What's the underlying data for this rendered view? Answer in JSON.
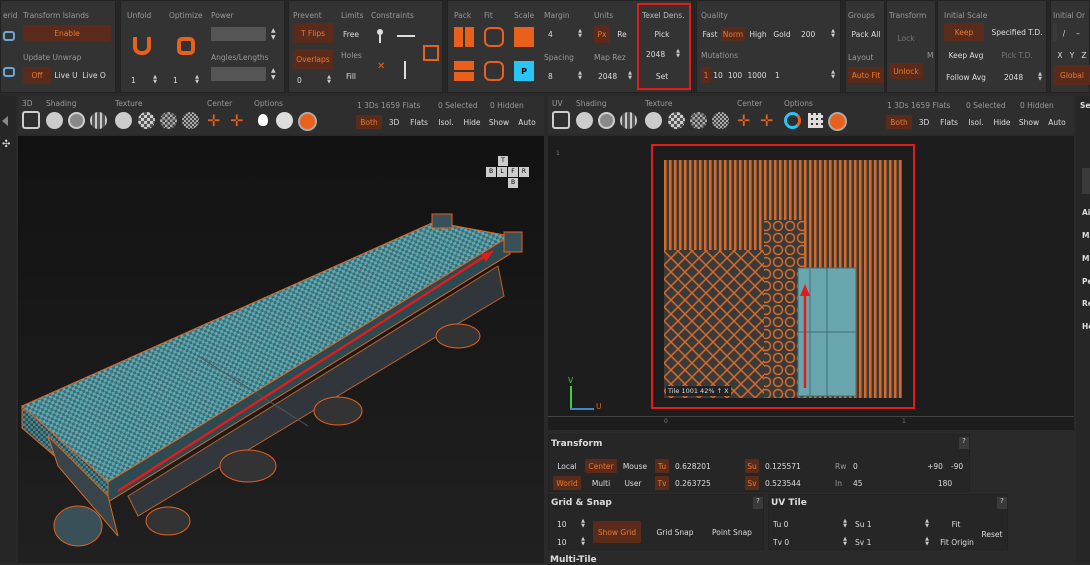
{
  "top": {
    "left_partial": {
      "erid": "erid",
      "transform_islands": "Transform Islands",
      "enable": "Enable",
      "update_unwrap": "Update Unwrap",
      "off": "Off",
      "live_u": "Live U",
      "live_o": "Live O"
    },
    "unfold": {
      "unfold": "Unfold",
      "optimize": "Optimize",
      "power": "Power",
      "angles": "Angles/Lengths",
      "v1": "1",
      "v2": "1"
    },
    "prevent": {
      "prevent": "Prevent",
      "tflips": "T Flips",
      "overlaps": "Overlaps",
      "limits": "Limits",
      "free": "Free",
      "holes": "Holes",
      "fill": "Fill",
      "constraints": "Constraints",
      "v0": "0"
    },
    "pack": {
      "pack": "Pack",
      "fit": "Fit",
      "scale": "Scale",
      "margin": "Margin",
      "margin_val": "4",
      "spacing": "Spacing",
      "spacing_val": "8",
      "units": "Units",
      "px": "Px",
      "re": "Re",
      "map_rez": "Map Rez",
      "map_rez_val": "2048"
    },
    "texel": {
      "title": "Texel Dens.",
      "pick": "Pick",
      "val": "2048",
      "set": "Set"
    },
    "quality": {
      "quality": "Quality",
      "fast": "Fast",
      "norm": "Norm",
      "high": "High",
      "gold": "Gold",
      "gold_val": "200",
      "mutations": "Mutations",
      "m1": "1",
      "m10": "10",
      "m100": "100",
      "m1000": "1000",
      "mval": "1"
    },
    "groups": {
      "groups": "Groups",
      "pack_all": "Pack All",
      "layout": "Layout",
      "auto_fit": "Auto Fit"
    },
    "transform": {
      "transform": "Transform",
      "lock": "Lock",
      "unlock": "Unlock",
      "m": "M"
    },
    "initial_scale": {
      "title": "Initial Scale",
      "keep": "Keep",
      "specified": "Specified T.D.",
      "keep_avg": "Keep Avg",
      "pick_td": "Pick T.D.",
      "follow_avg": "Follow Avg",
      "follow_val": "2048"
    },
    "initial_or": {
      "title": "Initial Or",
      "slash": "/",
      "dash": "–",
      "x": "X",
      "y": "Y",
      "z": "Z",
      "global": "Global"
    }
  },
  "view3d": {
    "tabs": [
      "3D",
      "Shading",
      "Texture",
      "Center",
      "Options"
    ],
    "info": "1 3Ds 1659 Flats",
    "selected": "0 Selected",
    "hidden": "0 Hidden",
    "filters": [
      "Both",
      "3D",
      "Flats",
      "Isol.",
      "Hide",
      "Show",
      "Auto"
    ],
    "cube": {
      "t": "T",
      "b": "B",
      "l": "L",
      "f": "F",
      "r": "R",
      "bk": "B"
    }
  },
  "viewuv": {
    "tabs": [
      "UV",
      "Shading",
      "Texture",
      "Center",
      "Options"
    ],
    "info": "1 3Ds 1659 Flats",
    "selected": "0 Selected",
    "hidden": "0 Hidden",
    "filters": [
      "Both",
      "3D",
      "Flats",
      "Isol.",
      "Hide",
      "Show",
      "Auto"
    ],
    "tile_label": "Tile 1001 42% ↑ X",
    "axis_v": "V",
    "axis_u": "U",
    "ruler_1": "1",
    "ruler_0": "0",
    "ruler_1b": "1"
  },
  "transform_panel": {
    "title": "Transform",
    "help": "?",
    "local": "Local",
    "center": "Center",
    "mouse": "Mouse",
    "world": "World",
    "multi": "Multi",
    "user": "User",
    "tu": "Tu",
    "tu_val": "0.628201",
    "tv": "Tv",
    "tv_val": "0.263725",
    "su": "Su",
    "su_val": "0.125571",
    "sv": "Sv",
    "sv_val": "0.523544",
    "rw": "Rw",
    "rw_val": "0",
    "in": "In",
    "in_val": "45",
    "p90": "+90",
    "m90": "-90",
    "r180": "180"
  },
  "grid_panel": {
    "title": "Grid & Snap",
    "help": "?",
    "v1": "10",
    "v2": "10",
    "show_grid": "Show Grid",
    "grid_snap": "Grid Snap",
    "point_snap": "Point Snap"
  },
  "uvtile_panel": {
    "title": "UV Tile",
    "help": "?",
    "tu": "Tu 0",
    "tv": "Tv 0",
    "su": "Su 1",
    "sv": "Sv 1",
    "fit": "Fit",
    "fit_origin": "Fit Origin",
    "reset": "Reset"
  },
  "multitile": {
    "title": "Multi-Tile"
  },
  "right_partial": [
    "Se",
    "Ai",
    "M",
    "M",
    "Pe",
    "Re",
    "He"
  ],
  "colors": {
    "accent": "#e06020",
    "highlight": "#e21b1b",
    "checker_a": "#5fa8b0",
    "checker_b": "#3c6e78"
  }
}
